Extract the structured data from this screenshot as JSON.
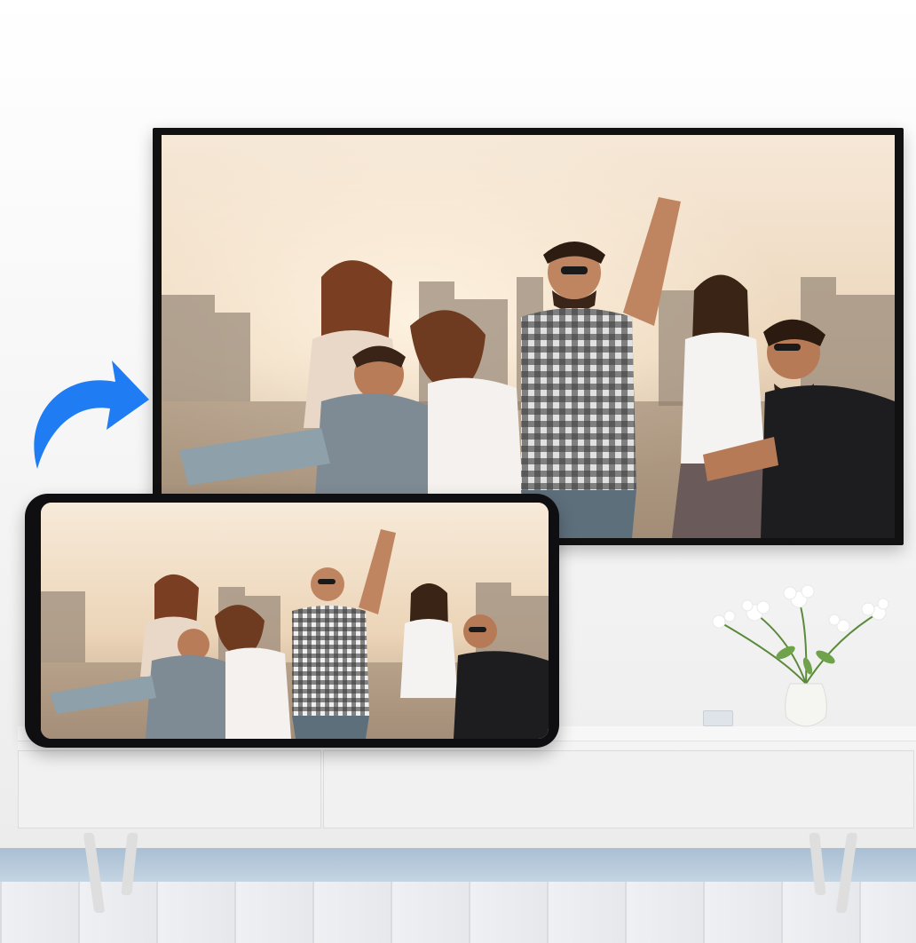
{
  "scene": {
    "description_tags": [
      "tv-mirroring",
      "phone-to-tv-cast"
    ],
    "accent_arrow_color": "#1f7cf3",
    "tv_frame_color": "#111111",
    "phone_frame_color": "#0f0f12",
    "sky_top_color": "#f6e8d7",
    "sky_bottom_color": "#e2c7a4"
  }
}
